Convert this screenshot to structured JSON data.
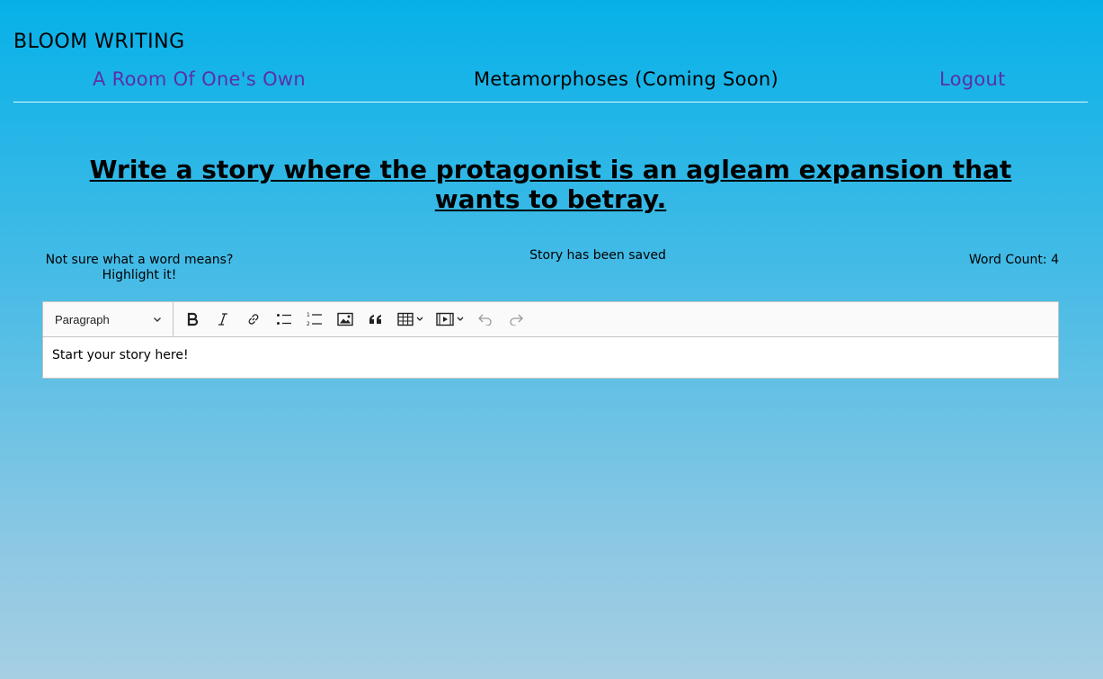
{
  "app": {
    "brand": "BLOOM WRITING"
  },
  "nav": {
    "items": [
      {
        "label": "A Room Of One's Own"
      },
      {
        "label": "Metamorphoses (Coming Soon)"
      },
      {
        "label": "Logout"
      }
    ]
  },
  "prompt": {
    "text": "Write a story where the protagonist is an agleam expansion that wants to betray."
  },
  "hint": {
    "line1": "Not sure what a word means?",
    "line2": "Highlight it!"
  },
  "status": {
    "saved": "Story has been saved"
  },
  "word_count": {
    "label": "Word Count: 4"
  },
  "editor": {
    "block_format": "Paragraph",
    "content": "Start your story here!",
    "toolbar_icons": [
      "bold-icon",
      "italic-icon",
      "link-icon",
      "bulleted-list-icon",
      "numbered-list-icon",
      "image-icon",
      "quote-icon",
      "table-icon",
      "media-icon",
      "undo-icon",
      "redo-icon"
    ]
  },
  "colors": {
    "nav_link": "#5b2fa8",
    "background_top": "#06b1e8",
    "background_bottom": "#a6cfe3"
  }
}
